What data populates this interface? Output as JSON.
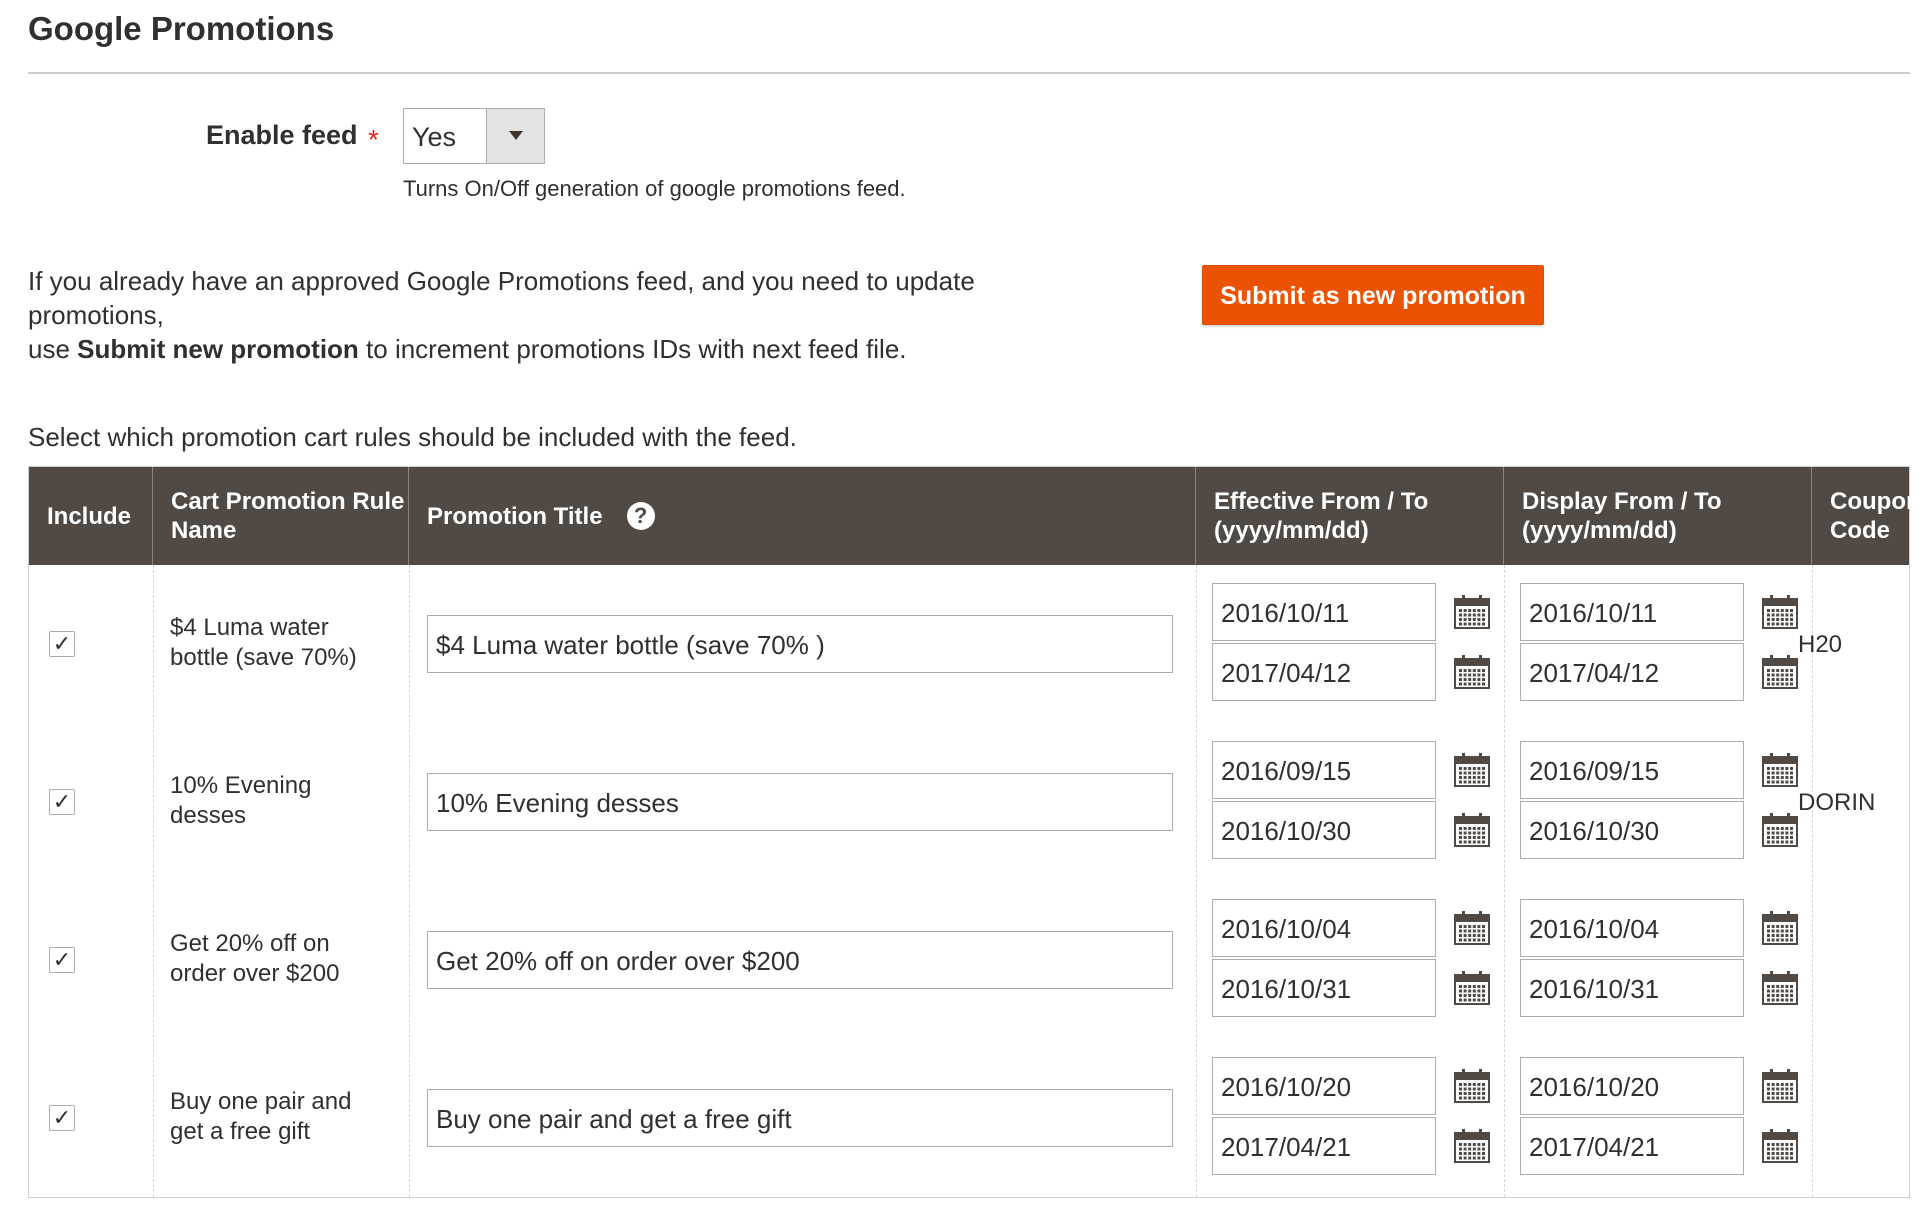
{
  "page": {
    "title": "Google Promotions"
  },
  "enable_feed": {
    "label": "Enable feed",
    "required_mark": "*",
    "value": "Yes",
    "note": "Turns On/Off generation of google promotions feed."
  },
  "info": {
    "line1": "If you already have an approved Google Promotions feed, and you need to update promotions,",
    "line2_prefix": "use ",
    "line2_bold": "Submit new promotion",
    "line2_suffix": " to increment promotions IDs with next feed file."
  },
  "submit_button": {
    "label": "Submit as new promotion"
  },
  "select_text": "Select which promotion cart rules should be included with the feed.",
  "table": {
    "headers": {
      "include": "Include",
      "rule_name": "Cart Promotion Rule Name",
      "promotion_title": "Promotion Title",
      "help": "?",
      "effective": "Effective From / To (yyyy/mm/dd)",
      "display": "Display From / To (yyyy/mm/dd)",
      "coupon": "Coupon Code"
    },
    "rows": [
      {
        "checked": "✓",
        "rule_name": "$4 Luma water bottle (save 70%)",
        "title": "$4 Luma water bottle (save 70% )",
        "effective_from": "2016/10/11",
        "effective_to": "2017/04/12",
        "display_from": "2016/10/11",
        "display_to": "2017/04/12",
        "coupon": "H20"
      },
      {
        "checked": "✓",
        "rule_name": "10% Evening desses",
        "title": "10% Evening desses",
        "effective_from": "2016/09/15",
        "effective_to": "2016/10/30",
        "display_from": "2016/09/15",
        "display_to": "2016/10/30",
        "coupon": "DORIN"
      },
      {
        "checked": "✓",
        "rule_name": "Get 20% off on order over $200",
        "title": "Get 20% off on order over $200",
        "effective_from": "2016/10/04",
        "effective_to": "2016/10/31",
        "display_from": "2016/10/04",
        "display_to": "2016/10/31",
        "coupon": ""
      },
      {
        "checked": "✓",
        "rule_name": "Buy one pair and get a free gift",
        "title": "Buy one pair and get a free gift",
        "effective_from": "2016/10/20",
        "effective_to": "2017/04/21",
        "display_from": "2016/10/20",
        "display_to": "2017/04/21",
        "coupon": ""
      }
    ]
  },
  "colors": {
    "header_bg": "#514943",
    "accent_button": "#eb5202",
    "required": "#e22626"
  },
  "icons": {
    "date_picker": "calendar-icon",
    "help": "question-circle-icon",
    "dropdown": "triangle-down-icon",
    "check": "checkmark-icon"
  }
}
